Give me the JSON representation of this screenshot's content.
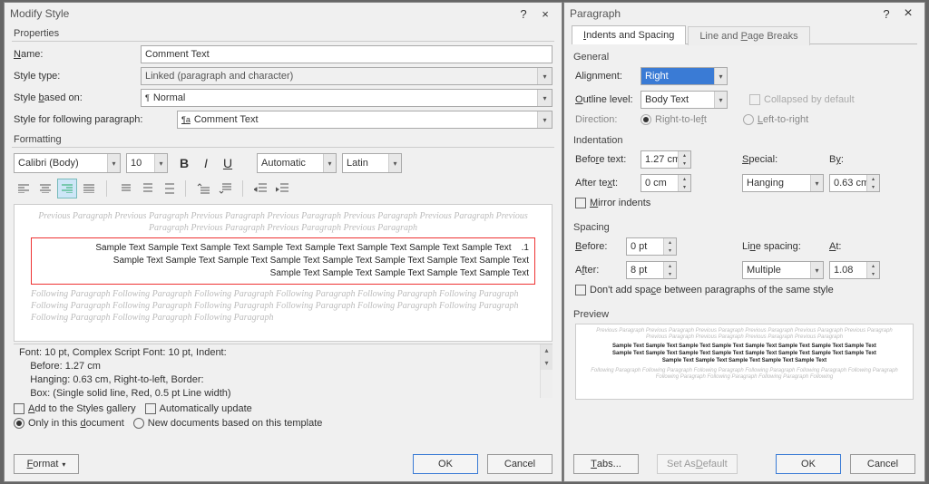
{
  "modify": {
    "title": "Modify Style",
    "help": "?",
    "close": "×",
    "sections": {
      "properties": "Properties",
      "formatting": "Formatting"
    },
    "labels": {
      "name": "Name:",
      "type": "Style type:",
      "based": "Style based on:",
      "following": "Style for following paragraph:"
    },
    "values": {
      "name": "Comment Text",
      "type": "Linked (paragraph and character)",
      "based": "Normal",
      "following": "Comment Text"
    },
    "format": {
      "font": "Calibri (Body)",
      "size": "10",
      "color": "Automatic",
      "script": "Latin"
    },
    "preview_gray1": "Previous Paragraph Previous Paragraph Previous Paragraph Previous Paragraph Previous Paragraph Previous Paragraph Previous Paragraph Previous Paragraph Previous Paragraph Previous Paragraph",
    "sample_l1": "Sample Text Sample Text Sample Text Sample Text Sample Text Sample Text Sample Text Sample Text    .1",
    "sample_l2": "Sample Text Sample Text Sample Text Sample Text Sample Text Sample Text Sample Text Sample Text",
    "sample_l3": "Sample Text Sample Text Sample Text Sample Text Sample Text",
    "preview_gray2": "Following Paragraph Following Paragraph Following Paragraph Following Paragraph Following Paragraph Following Paragraph Following Paragraph Following Paragraph Following Paragraph Following Paragraph Following Paragraph Following Paragraph Following Paragraph Following Paragraph Following Paragraph",
    "desc_l1": "Font: 10 pt, Complex Script Font: 10 pt, Indent:",
    "desc_l2": "    Before:  1.27 cm",
    "desc_l3": "    Hanging:  0.63 cm, Right-to-left, Border:",
    "desc_l4": "    Box: (Single solid line, Red,  0.5 pt Line width)",
    "checks": {
      "gallery": "Add to the Styles gallery",
      "auto": "Automatically update",
      "doc": "Only in this document",
      "templ": "New documents based on this template"
    },
    "buttons": {
      "format": "Format",
      "ok": "OK",
      "cancel": "Cancel"
    }
  },
  "para": {
    "title": "Paragraph",
    "help": "?",
    "close": "×",
    "tabs": {
      "indents": "Indents and Spacing",
      "breaks": "Line and Page Breaks"
    },
    "general": "General",
    "alignment_label": "Alignment:",
    "alignment": "Right",
    "outline_label": "Outline level:",
    "outline": "Body Text",
    "collapsed": "Collapsed by default",
    "direction_label": "Direction:",
    "rtl": "Right-to-left",
    "ltr": "Left-to-right",
    "indentation": "Indentation",
    "before_text_label": "Before text:",
    "before_text": "1.27 cm",
    "after_text_label": "After text:",
    "after_text": "0 cm",
    "special_label": "Special:",
    "special": "Hanging",
    "by_label": "By:",
    "by": "0.63 cm",
    "mirror": "Mirror indents",
    "spacing": "Spacing",
    "sp_before_label": "Before:",
    "sp_before": "0 pt",
    "sp_after_label": "After:",
    "sp_after": "8 pt",
    "linespacing_label": "Line spacing:",
    "linespacing": "Multiple",
    "at_label": "At:",
    "at": "1.08",
    "dontadd": "Don't add space between paragraphs of the same style",
    "preview": "Preview",
    "pp_prev": "Previous Paragraph Previous Paragraph Previous Paragraph Previous Paragraph Previous Paragraph Previous Paragraph Previous Paragraph Previous Paragraph Previous Paragraph Previous Paragraph",
    "pp_s1": "Sample Text Sample Text Sample Text Sample Text Sample Text Sample Text Sample Text Sample Text",
    "pp_s2": "Sample Text Sample Text Sample Text Sample Text Sample Text Sample Text Sample Text Sample Text",
    "pp_s3": "Sample Text Sample Text Sample Text Sample Text Sample Text",
    "pp_foll": "Following Paragraph Following Paragraph Following Paragraph Following Paragraph Following Paragraph Following Paragraph Following Paragraph Following Paragraph Following Paragraph Following",
    "buttons": {
      "tabs": "Tabs...",
      "default": "Set As Default",
      "ok": "OK",
      "cancel": "Cancel"
    }
  }
}
